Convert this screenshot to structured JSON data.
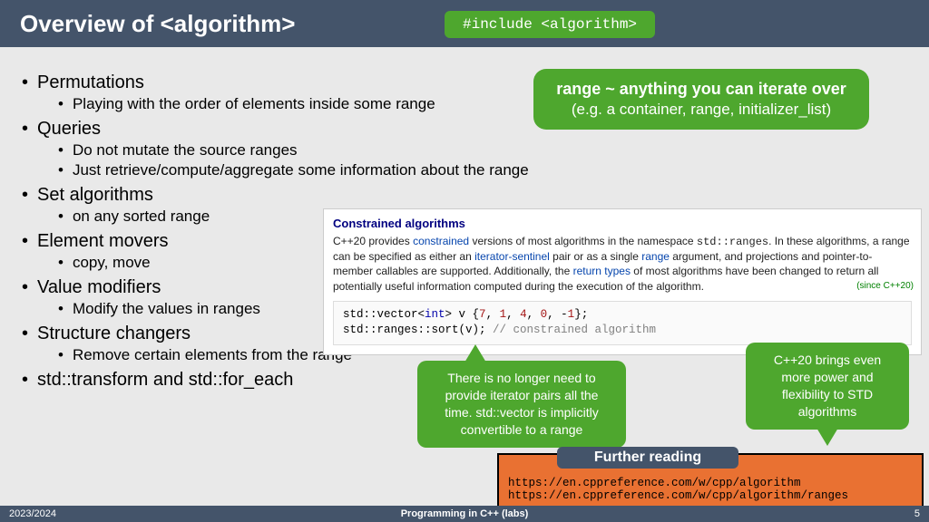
{
  "header": {
    "title": "Overview of <algorithm>",
    "include": "#include <algorithm>"
  },
  "bullets": {
    "b1": "Permutations",
    "b1a": "Playing with the order of elements inside some range",
    "b2": "Queries",
    "b2a": "Do not mutate the source ranges",
    "b2b": "Just retrieve/compute/aggregate some information about the range",
    "b3": "Set algorithms",
    "b3a": "on any sorted range",
    "b4": "Element movers",
    "b4a": "copy, move",
    "b5": "Value modifiers",
    "b5a": "Modify the values in ranges",
    "b6": "Structure changers",
    "b6a": "Remove certain elements from the range",
    "b7": "std::transform and std::for_each"
  },
  "range_box": {
    "line1": "range ~ anything you can iterate over",
    "line2": "(e.g. a container, range, initializer_list)"
  },
  "doc": {
    "title": "Constrained algorithms",
    "pre": "C++20 provides ",
    "l1": "constrained",
    "mid1": " versions of most algorithms in the namespace ",
    "ns": "std::ranges",
    "mid2": ". In these algorithms, a range can be specified as either an ",
    "l2": "iterator-sentinel",
    "mid3": " pair or as a single ",
    "l3": "range",
    "mid4": " argument, and projections and pointer-to-member callables are supported. Additionally, the ",
    "l4": "return types",
    "post": " of most algorithms have been changed to return all potentially useful information computed during the execution of the algorithm.",
    "since": "(since C++20)"
  },
  "code": {
    "l1a": "std::vector<",
    "l1b": "int",
    "l1c": "> v {",
    "l1d": "7",
    "l1e": ", ",
    "l1f": "1",
    "l1g": ", ",
    "l1h": "4",
    "l1i": ", ",
    "l1j": "0",
    "l1k": ", -",
    "l1l": "1",
    "l1m": "};",
    "l2a": "std::ranges::sort(v); ",
    "l2b": "// constrained algorithm"
  },
  "callout1": "There is no longer need to provide iterator pairs all the time. std::vector is implicitly convertible to a range",
  "callout2": "C++20 brings even more power and flexibility to STD algorithms",
  "further": {
    "title": "Further reading",
    "url1": "https://en.cppreference.com/w/cpp/algorithm",
    "url2": "https://en.cppreference.com/w/cpp/algorithm/ranges"
  },
  "footer": {
    "left": "2023/2024",
    "mid": "Programming in C++ (labs)",
    "right": "5"
  }
}
